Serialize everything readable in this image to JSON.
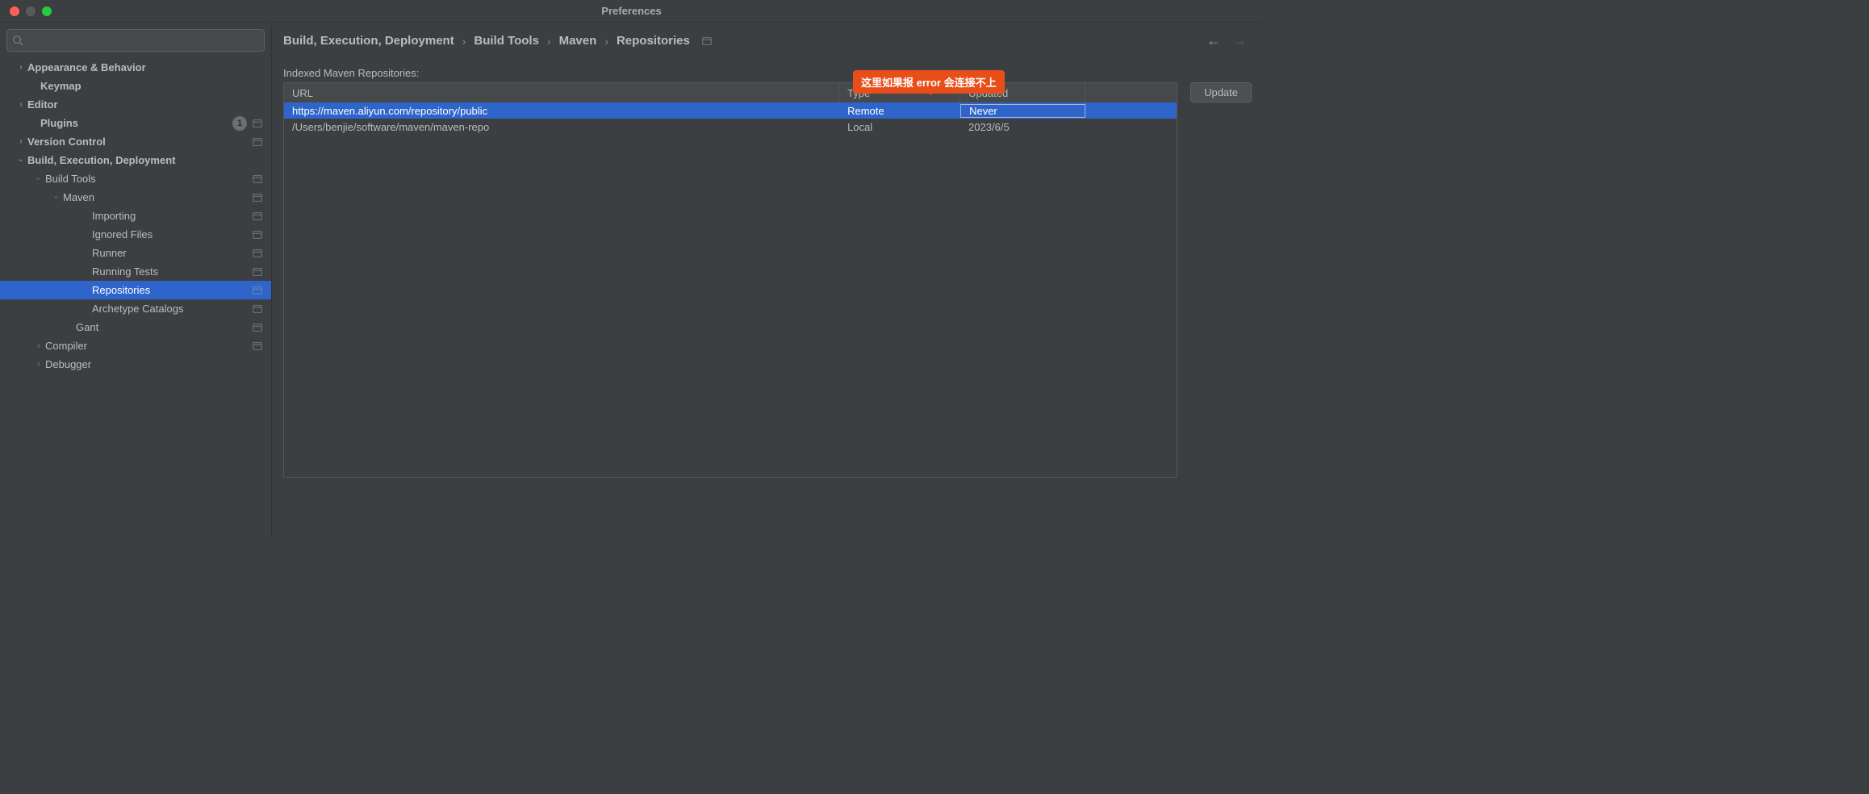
{
  "window": {
    "title": "Preferences"
  },
  "search": {
    "placeholder": ""
  },
  "sidebar": {
    "items": [
      {
        "label": "Appearance & Behavior",
        "indent": 18,
        "bold": true,
        "chevron": "right",
        "badge": null,
        "icon": false,
        "selected": false
      },
      {
        "label": "Keymap",
        "indent": 34,
        "bold": true,
        "chevron": "",
        "badge": null,
        "icon": false,
        "selected": false
      },
      {
        "label": "Editor",
        "indent": 18,
        "bold": true,
        "chevron": "right",
        "badge": null,
        "icon": false,
        "selected": false
      },
      {
        "label": "Plugins",
        "indent": 34,
        "bold": true,
        "chevron": "",
        "badge": "1",
        "icon": true,
        "selected": false
      },
      {
        "label": "Version Control",
        "indent": 18,
        "bold": true,
        "chevron": "right",
        "badge": null,
        "icon": true,
        "selected": false
      },
      {
        "label": "Build, Execution, Deployment",
        "indent": 18,
        "bold": true,
        "chevron": "down",
        "badge": null,
        "icon": false,
        "selected": false
      },
      {
        "label": "Build Tools",
        "indent": 40,
        "bold": false,
        "chevron": "down",
        "badge": null,
        "icon": true,
        "selected": false
      },
      {
        "label": "Maven",
        "indent": 62,
        "bold": false,
        "chevron": "down",
        "badge": null,
        "icon": true,
        "selected": false
      },
      {
        "label": "Importing",
        "indent": 98,
        "bold": false,
        "chevron": "",
        "badge": null,
        "icon": true,
        "selected": false
      },
      {
        "label": "Ignored Files",
        "indent": 98,
        "bold": false,
        "chevron": "",
        "badge": null,
        "icon": true,
        "selected": false
      },
      {
        "label": "Runner",
        "indent": 98,
        "bold": false,
        "chevron": "",
        "badge": null,
        "icon": true,
        "selected": false
      },
      {
        "label": "Running Tests",
        "indent": 98,
        "bold": false,
        "chevron": "",
        "badge": null,
        "icon": true,
        "selected": false
      },
      {
        "label": "Repositories",
        "indent": 98,
        "bold": false,
        "chevron": "",
        "badge": null,
        "icon": true,
        "selected": true
      },
      {
        "label": "Archetype Catalogs",
        "indent": 98,
        "bold": false,
        "chevron": "",
        "badge": null,
        "icon": true,
        "selected": false
      },
      {
        "label": "Gant",
        "indent": 78,
        "bold": false,
        "chevron": "",
        "badge": null,
        "icon": true,
        "selected": false
      },
      {
        "label": "Compiler",
        "indent": 40,
        "bold": false,
        "chevron": "right",
        "badge": null,
        "icon": true,
        "selected": false
      },
      {
        "label": "Debugger",
        "indent": 40,
        "bold": false,
        "chevron": "right",
        "badge": null,
        "icon": false,
        "selected": false
      }
    ]
  },
  "breadcrumb": {
    "items": [
      "Build, Execution, Deployment",
      "Build Tools",
      "Maven",
      "Repositories"
    ]
  },
  "content": {
    "section_label": "Indexed Maven Repositories:",
    "columns": {
      "url": "URL",
      "type": "Type",
      "updated": "Updated"
    },
    "rows": [
      {
        "url": "https://maven.aliyun.com/repository/public",
        "type": "Remote",
        "updated": "Never",
        "selected": true,
        "editing": true
      },
      {
        "url": "/Users/benjie/software/maven/maven-repo",
        "type": "Local",
        "updated": "2023/6/5",
        "selected": false,
        "editing": false
      }
    ],
    "update_button": "Update"
  },
  "annotation": {
    "text": "这里如果报 error 会连接不上"
  }
}
